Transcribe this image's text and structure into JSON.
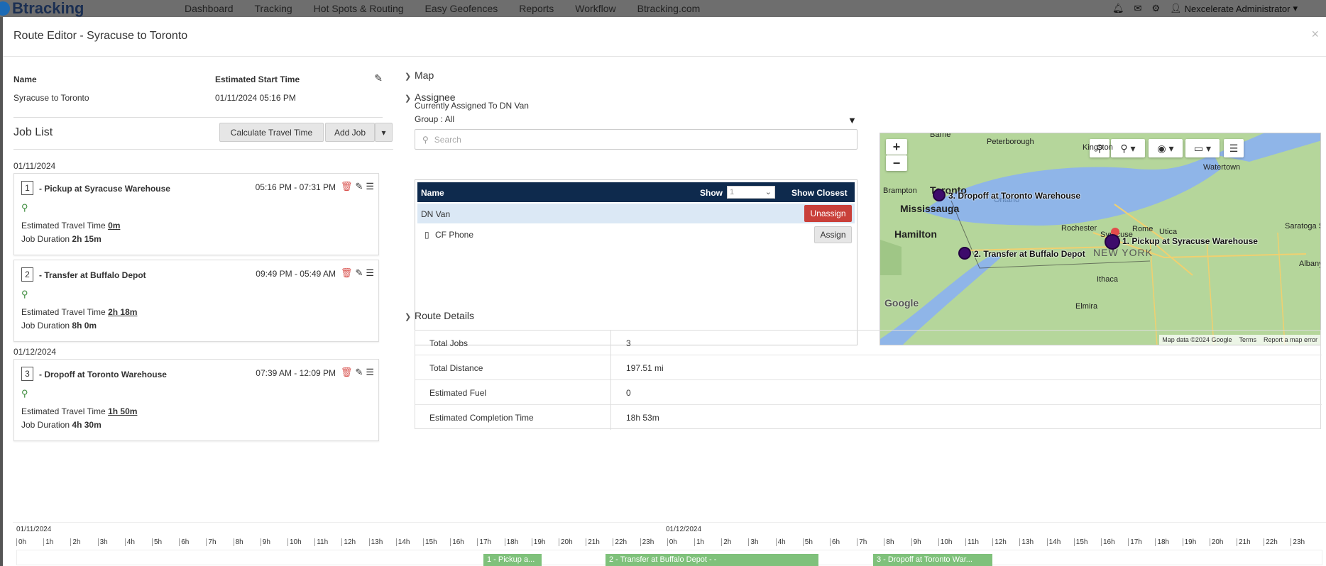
{
  "topbar": {
    "logo": "Btracking",
    "nav": [
      "Dashboard",
      "Tracking",
      "Hot Spots & Routing",
      "Easy Geofences",
      "Reports",
      "Workflow",
      "Btracking.com"
    ],
    "user": "Nexcelerate Administrator"
  },
  "modal": {
    "title": "Route Editor - Syracuse to Toronto",
    "close": "×"
  },
  "route": {
    "name_label": "Name",
    "name_value": "Syracuse to Toronto",
    "start_label": "Estimated Start Time",
    "start_value": "01/11/2024 05:16 PM"
  },
  "joblist": {
    "title": "Job List",
    "calc_button": "Calculate Travel Time",
    "add_button": "Add Job",
    "dates": [
      "01/11/2024",
      "01/12/2024"
    ],
    "jobs": [
      {
        "num": "1",
        "name": "- Pickup at Syracuse Warehouse",
        "time": "05:16 PM - 07:31 PM",
        "travel_label": "Estimated Travel Time",
        "travel": "0m",
        "duration_label": "Job Duration",
        "duration": "2h 15m"
      },
      {
        "num": "2",
        "name": "- Transfer at Buffalo Depot",
        "time": "09:49 PM - 05:49 AM",
        "travel_label": "Estimated Travel Time",
        "travel": "2h 18m",
        "duration_label": "Job Duration",
        "duration": "8h 0m"
      },
      {
        "num": "3",
        "name": "- Dropoff at Toronto Warehouse",
        "time": "07:39 AM - 12:09 PM",
        "travel_label": "Estimated Travel Time",
        "travel": "1h 50m",
        "duration_label": "Job Duration",
        "duration": "4h 30m"
      }
    ]
  },
  "sections": {
    "map": "Map",
    "assignee": "Assignee",
    "route_details": "Route Details"
  },
  "assignee": {
    "current": "Currently Assigned To DN Van",
    "group": "Group : All",
    "search_placeholder": "Search",
    "col_name": "Name",
    "col_show": "Show",
    "show_value": "1",
    "show_closest": "Show Closest",
    "rows": [
      {
        "name": "DN Van",
        "action": "Unassign"
      },
      {
        "name": "CF Phone",
        "action": "Assign"
      }
    ]
  },
  "map": {
    "zoom_in": "+",
    "zoom_out": "−",
    "labels": {
      "m1": "1. Pickup at Syracuse Warehouse",
      "m2": "2. Transfer at Buffalo Depot",
      "m3": "3. Dropoff at Toronto Warehouse"
    },
    "cities": [
      "Barrie",
      "Peterborough",
      "Kingston",
      "Watertown",
      "Brampton",
      "Toronto",
      "Mississauga",
      "Hamilton",
      "Rochester",
      "Syracuse",
      "Rome",
      "Utica",
      "Saratoga Springs",
      "NEW YORK",
      "Ithaca",
      "Elmira",
      "Albany",
      "Ontario"
    ],
    "footer": [
      "Map data ©2024 Google",
      "Terms",
      "Report a map error"
    ],
    "google": "Google"
  },
  "details": [
    {
      "key": "Total Jobs",
      "value": "3"
    },
    {
      "key": "Total Distance",
      "value": "197.51 mi"
    },
    {
      "key": "Estimated Fuel",
      "value": "0"
    },
    {
      "key": "Estimated Completion Time",
      "value": "18h 53m"
    }
  ],
  "timeline": {
    "dates": [
      "01/11/2024",
      "01/12/2024"
    ],
    "hours": [
      "0h",
      "1h",
      "2h",
      "3h",
      "4h",
      "5h",
      "6h",
      "7h",
      "8h",
      "9h",
      "10h",
      "11h",
      "12h",
      "13h",
      "14h",
      "15h",
      "16h",
      "17h",
      "18h",
      "19h",
      "20h",
      "21h",
      "22h",
      "23h"
    ],
    "bars": [
      "1 - Pickup a...",
      "2 - Transfer at Buffalo Depot - -",
      "3 - Dropoff at Toronto War..."
    ]
  },
  "colors": {
    "header_navy": "#0e2a4d",
    "unassign_red": "#c9403a",
    "bar_green": "#7fc17b",
    "pin_green": "#3c8b3c"
  }
}
